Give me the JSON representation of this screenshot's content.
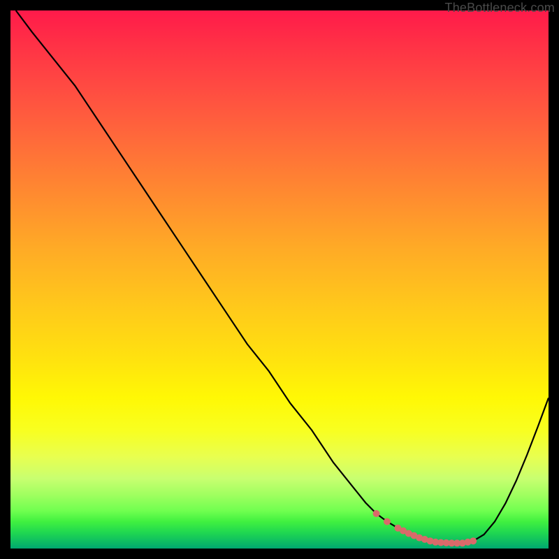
{
  "watermark": "TheBottleneck.com",
  "chart_data": {
    "type": "line",
    "title": "",
    "xlabel": "",
    "ylabel": "",
    "xlim": [
      0,
      100
    ],
    "ylim": [
      0,
      100
    ],
    "grid": false,
    "series": [
      {
        "name": "bottleneck-curve",
        "x": [
          1,
          4,
          8,
          12,
          16,
          20,
          24,
          28,
          32,
          36,
          40,
          44,
          48,
          52,
          56,
          60,
          64,
          66,
          68,
          70,
          72,
          74,
          76,
          78,
          80,
          82,
          84,
          86,
          88,
          90,
          92,
          94,
          96,
          98,
          100
        ],
        "y": [
          100,
          96,
          91,
          86,
          80,
          74,
          68,
          62,
          56,
          50,
          44,
          38,
          33,
          27,
          22,
          16,
          11,
          8.5,
          6.5,
          5.0,
          3.8,
          2.8,
          2.0,
          1.4,
          1.1,
          1.0,
          1.0,
          1.4,
          2.6,
          5.0,
          8.4,
          12.6,
          17.4,
          22.6,
          28.0
        ]
      }
    ],
    "markers": {
      "name": "optimum-points",
      "x": [
        68,
        70,
        72,
        73,
        74,
        75,
        76,
        77,
        78,
        79,
        80,
        81,
        82,
        83,
        84,
        85,
        86
      ],
      "y": [
        6.5,
        5.0,
        3.8,
        3.3,
        2.8,
        2.4,
        2.0,
        1.7,
        1.4,
        1.2,
        1.1,
        1.05,
        1.0,
        1.0,
        1.0,
        1.2,
        1.4
      ],
      "color": "#d96a6a",
      "radius": 5
    },
    "colors": {
      "curve": "#000000",
      "background_gradient": [
        "#ff1a4a",
        "#ffaa26",
        "#fff805",
        "#00a870"
      ]
    }
  }
}
